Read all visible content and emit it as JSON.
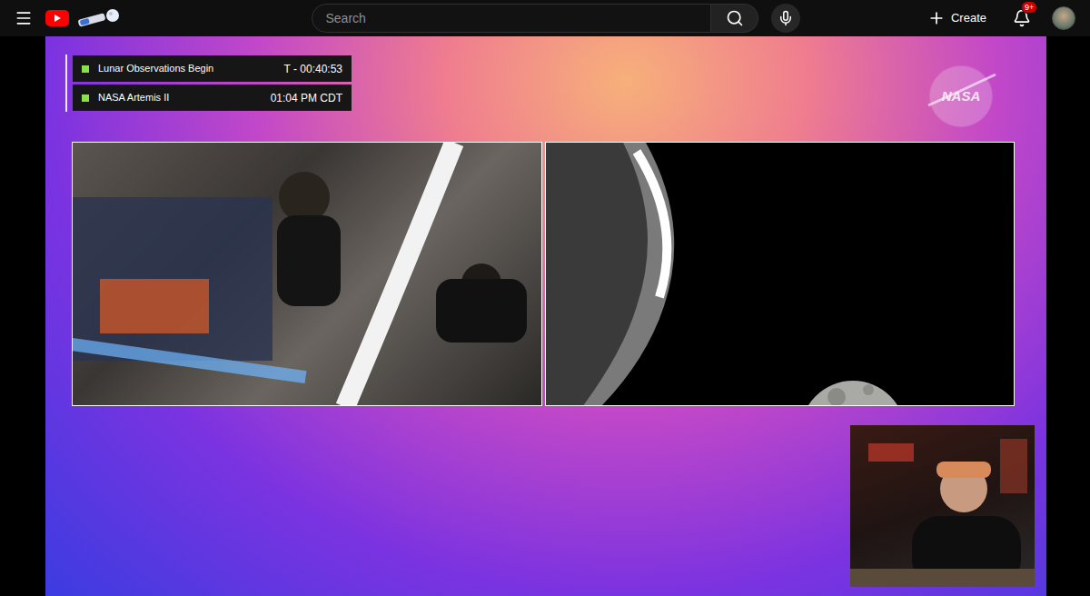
{
  "header": {
    "search": {
      "placeholder": "Search"
    },
    "create_button": "Create",
    "notifications": {
      "badge": "9+"
    }
  },
  "video": {
    "labels": [
      {
        "title": "Lunar Observations Begin",
        "value": "T - 00:40:53"
      },
      {
        "title": "NASA Artemis II",
        "value": "01:04 PM CDT"
      }
    ],
    "logo": "NASA"
  }
}
